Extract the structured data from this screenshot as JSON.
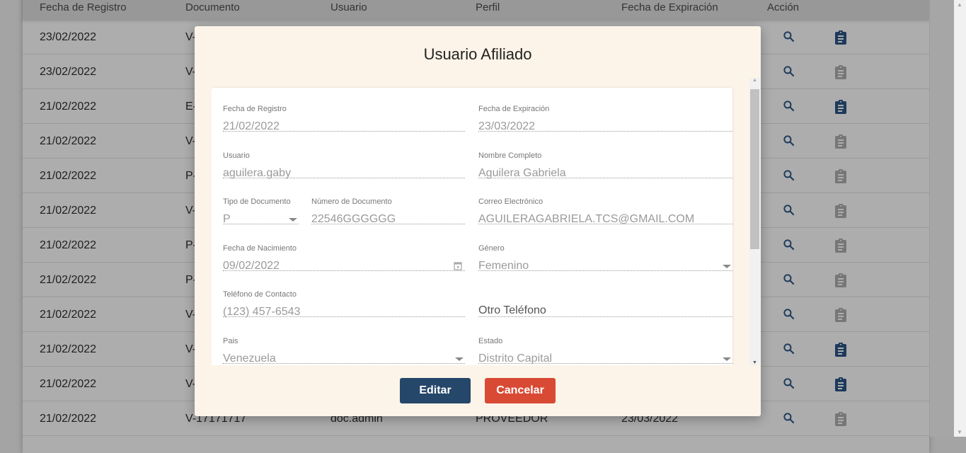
{
  "table": {
    "headers": [
      "Fecha de Registro",
      "Documento",
      "Usuario",
      "Perfil",
      "Fecha de Expiración",
      "Acción"
    ],
    "rows": [
      {
        "fecha": "23/02/2022",
        "doc": "V-",
        "usuario": "",
        "perfil": "",
        "exp": "",
        "clip_active": true
      },
      {
        "fecha": "23/02/2022",
        "doc": "V-",
        "usuario": "",
        "perfil": "",
        "exp": "",
        "clip_active": false
      },
      {
        "fecha": "21/02/2022",
        "doc": "E-",
        "usuario": "",
        "perfil": "",
        "exp": "",
        "clip_active": true
      },
      {
        "fecha": "21/02/2022",
        "doc": "V-",
        "usuario": "",
        "perfil": "",
        "exp": "",
        "clip_active": false
      },
      {
        "fecha": "21/02/2022",
        "doc": "P-",
        "usuario": "",
        "perfil": "",
        "exp": "",
        "clip_active": false
      },
      {
        "fecha": "21/02/2022",
        "doc": "V-",
        "usuario": "",
        "perfil": "",
        "exp": "",
        "clip_active": false
      },
      {
        "fecha": "21/02/2022",
        "doc": "P-",
        "usuario": "",
        "perfil": "",
        "exp": "",
        "clip_active": false
      },
      {
        "fecha": "21/02/2022",
        "doc": "P-",
        "usuario": "",
        "perfil": "",
        "exp": "",
        "clip_active": false
      },
      {
        "fecha": "21/02/2022",
        "doc": "V-",
        "usuario": "",
        "perfil": "",
        "exp": "",
        "clip_active": false
      },
      {
        "fecha": "21/02/2022",
        "doc": "V-",
        "usuario": "",
        "perfil": "",
        "exp": "",
        "clip_active": true
      },
      {
        "fecha": "21/02/2022",
        "doc": "V-",
        "usuario": "",
        "perfil": "",
        "exp": "",
        "clip_active": true
      },
      {
        "fecha": "21/02/2022",
        "doc": "V-17171717",
        "usuario": "doc.admin",
        "perfil": "PROVEEDOR",
        "exp": "23/03/2022",
        "clip_active": false
      }
    ]
  },
  "modal": {
    "title": "Usuario Afiliado",
    "fields": {
      "fecha_registro": {
        "label": "Fecha de Registro",
        "value": "21/02/2022"
      },
      "fecha_expiracion": {
        "label": "Fecha de Expiración",
        "value": "23/03/2022"
      },
      "usuario": {
        "label": "Usuario",
        "value": "aguilera.gaby"
      },
      "nombre": {
        "label": "Nombre Completo",
        "value": "Aguilera Gabriela"
      },
      "tipo_doc": {
        "label": "Tipo de Documento",
        "value": "P"
      },
      "num_doc": {
        "label": "Número de Documento",
        "value": "22546GGGGGG"
      },
      "correo": {
        "label": "Correo Electrónico",
        "value": "AGUILERAGABRIELA.TCS@GMAIL.COM"
      },
      "nacimiento": {
        "label": "Fecha de Nacimiento",
        "value": "09/02/2022"
      },
      "genero": {
        "label": "Género",
        "value": "Femenino"
      },
      "telefono": {
        "label": "Teléfono de Contacto",
        "value": "(123) 457-6543"
      },
      "otro_telefono": {
        "placeholder": "Otro Teléfono"
      },
      "pais": {
        "label": "Pais",
        "value": "Venezuela"
      },
      "estado": {
        "label": "Estado",
        "value": "Distrito Capital"
      }
    },
    "edit_label": "Editar",
    "cancel_label": "Cancelar"
  },
  "colors": {
    "edit": "#25476a",
    "cancel": "#d94a35",
    "icon_active": "#1d3a5c",
    "icon_inactive": "#777777",
    "modal_bg": "#fcf4e8"
  }
}
